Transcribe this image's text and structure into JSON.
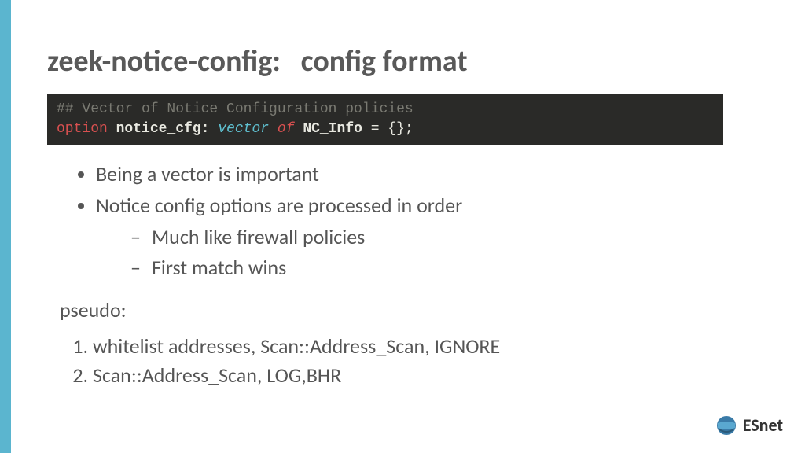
{
  "title": "zeek-notice-config:   config format",
  "code": {
    "comment": "## Vector of Notice Configuration policies",
    "option": "option",
    "ident": "notice_cfg:",
    "vector": "vector",
    "of": "of",
    "type": "NC_Info",
    "suffix": " = {};"
  },
  "bullets": {
    "b1": "Being a vector is important",
    "b2": "Notice config options are processed in order",
    "b2a": "Much like firewall policies",
    "b2b": "First match wins"
  },
  "pseudo_label": "pseudo:",
  "numbered": {
    "n1": "whitelist addresses, Scan::Address_Scan, IGNORE",
    "n2": "Scan::Address_Scan, LOG,BHR"
  },
  "logo_text": "ESnet"
}
